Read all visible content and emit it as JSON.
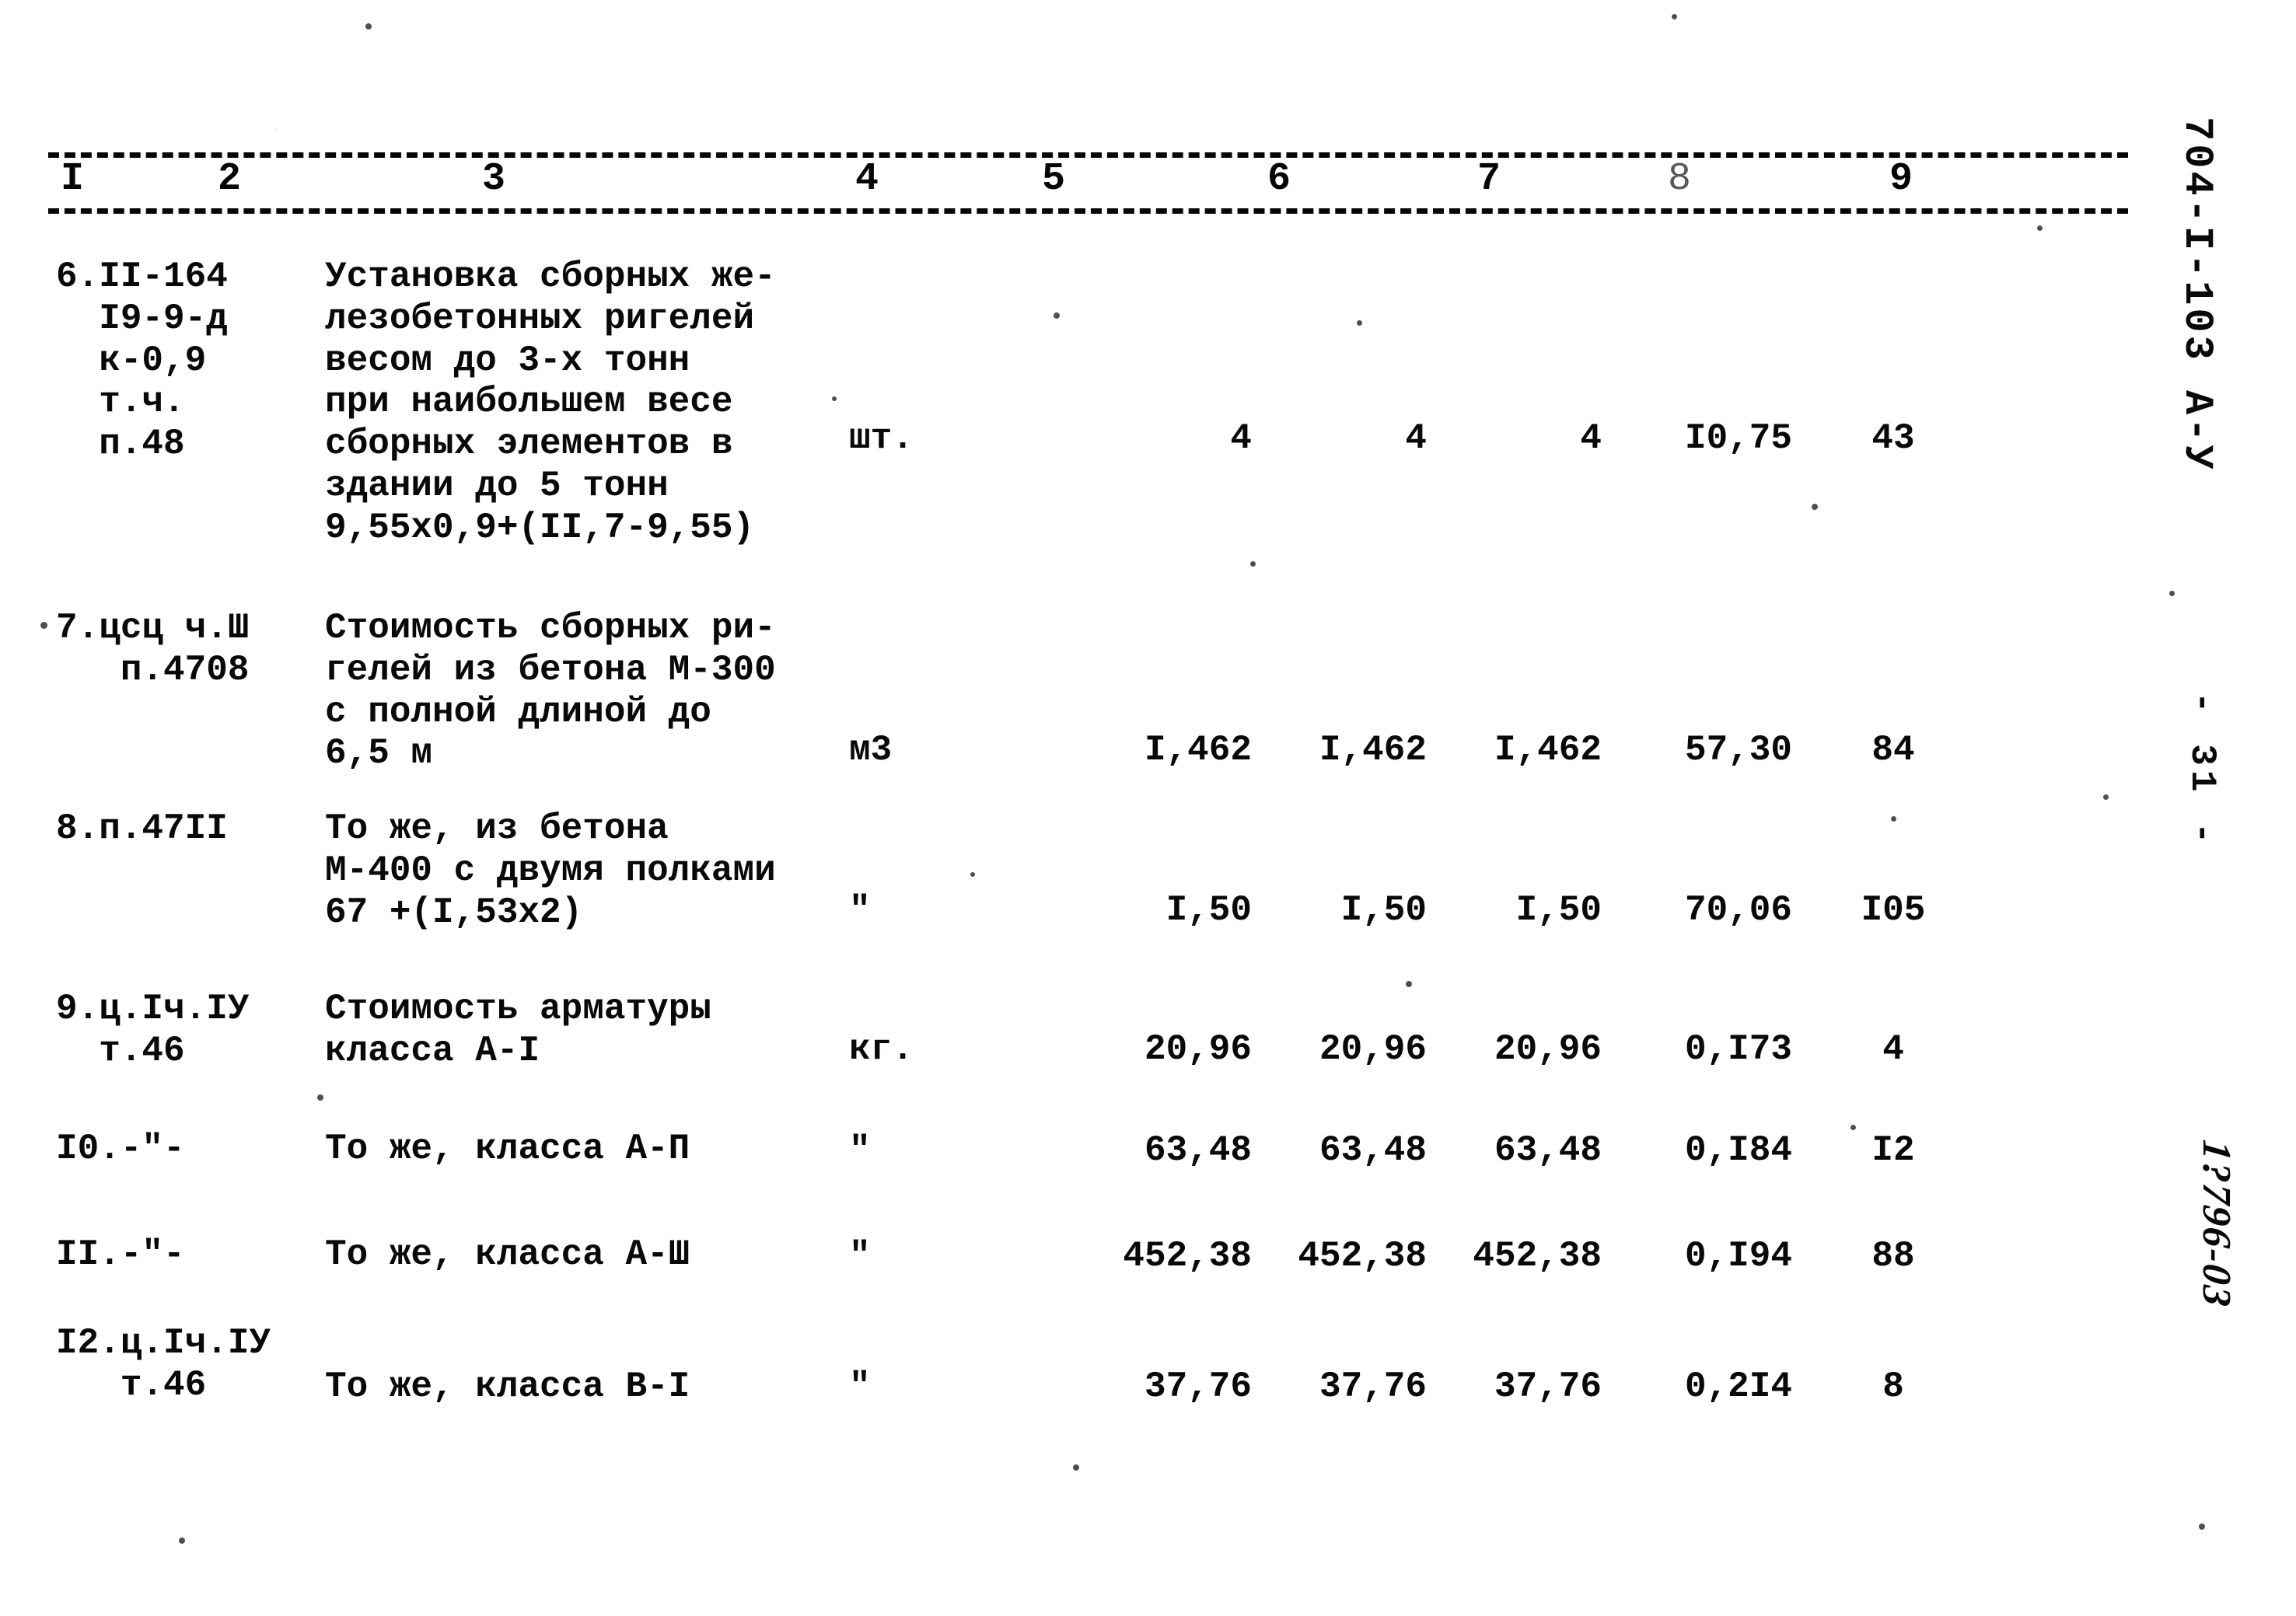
{
  "document": {
    "sheet_code": "704-I-103  А-У",
    "page_number": "- 31 -",
    "handwritten_note": "1?796-03"
  },
  "table": {
    "column_headers": [
      "I",
      "2",
      "3",
      "4",
      "5",
      "6",
      "7",
      "8",
      "9"
    ],
    "rows": [
      {
        "code": "6.II-164\n  I9-9-д\n  к-0,9\n  т.ч.\n  п.48",
        "description": "Установка сборных же-\nлезобетонных ригелей\nвесом до 3-х тонн\nпри наибольшем весе\nсборных элементов в\nздании до 5 тонн\n9,55х0,9+(II,7-9,55)",
        "unit": "шт.",
        "c5": "4",
        "c6": "4",
        "c7": "4",
        "c8": "I0,75",
        "c9": "43"
      },
      {
        "code": "7.цсц ч.Ш\n   п.4708",
        "description": "Стоимость сборных ри-\nгелей из бетона М-300\nс полной длиной до\n6,5 м",
        "unit": "м3",
        "c5": "I,462",
        "c6": "I,462",
        "c7": "I,462",
        "c8": "57,30",
        "c9": "84"
      },
      {
        "code": "8.п.47II",
        "description": "То же, из бетона\nМ-400 с двумя полками\n67 +(I,53х2)",
        "unit": "\"",
        "c5": "I,50",
        "c6": "I,50",
        "c7": "I,50",
        "c8": "70,06",
        "c9": "I05"
      },
      {
        "code": "9.ц.Iч.IУ\n  т.46",
        "description": "Стоимость арматуры\nкласса А-I",
        "unit": "кг.",
        "c5": "20,96",
        "c6": "20,96",
        "c7": "20,96",
        "c8": "0,I73",
        "c9": "4"
      },
      {
        "code": "I0.-\"-",
        "description": "То же, класса А-П",
        "unit": "\"",
        "c5": "63,48",
        "c6": "63,48",
        "c7": "63,48",
        "c8": "0,I84",
        "c9": "I2"
      },
      {
        "code": "II.-\"-",
        "description": "То же, класса А-Ш",
        "unit": "\"",
        "c5": "452,38",
        "c6": "452,38",
        "c7": "452,38",
        "c8": "0,I94",
        "c9": "88"
      },
      {
        "code": "I2.ц.Iч.IУ\n   т.46",
        "description": "То же, класса В-I",
        "unit": "\"",
        "c5": "37,76",
        "c6": "37,76",
        "c7": "37,76",
        "c8": "0,2I4",
        "c9": "8"
      }
    ]
  }
}
